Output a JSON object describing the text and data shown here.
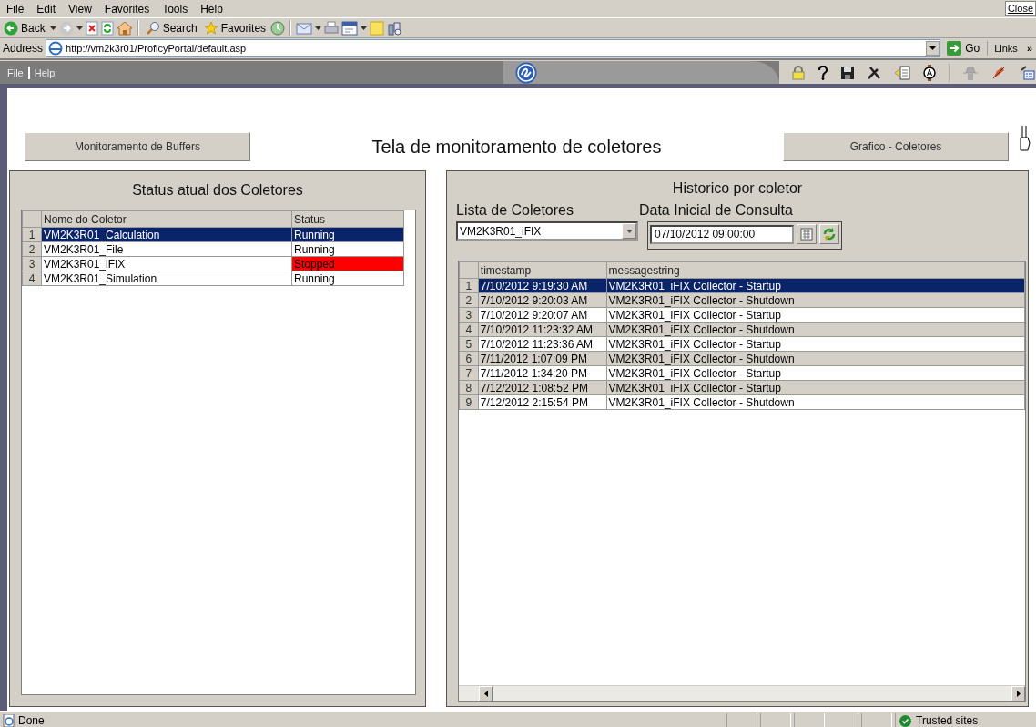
{
  "browser": {
    "menu": [
      "File",
      "Edit",
      "View",
      "Favorites",
      "Tools",
      "Help"
    ],
    "close_label": "Close",
    "toolbar": {
      "back": "Back",
      "search": "Search",
      "favorites": "Favorites"
    },
    "address": {
      "label": "Address",
      "value": "http://vm2k3r01/ProficyPortal/default.asp",
      "go": "Go",
      "links": "Links",
      "links_more": "»"
    }
  },
  "portal": {
    "menu": [
      "File",
      "Help"
    ]
  },
  "header": {
    "left_button": "Monitoramento de Buffers",
    "title": "Tela de monitoramento de coletores",
    "right_button": "Grafico - Coletores"
  },
  "status_panel": {
    "title": "Status atual dos Coletores",
    "columns": [
      "Nome do Coletor",
      "Status"
    ],
    "rows": [
      {
        "number": "1",
        "name": "VM2K3R01_Calculation",
        "status": "Running",
        "selected": true
      },
      {
        "number": "2",
        "name": "VM2K3R01_File",
        "status": "Running",
        "color": "#ffffff",
        "selected": false
      },
      {
        "number": "3",
        "name": "VM2K3R01_iFIX",
        "status": "Stopped",
        "color": "#ff0000",
        "selected": false
      },
      {
        "number": "4",
        "name": "VM2K3R01_Simulation",
        "status": "Running",
        "color": "#ffffff",
        "selected": false
      }
    ]
  },
  "history_panel": {
    "title": "Historico por coletor",
    "collector_label": "Lista de Coletores",
    "collector_value": "VM2K3R01_iFIX",
    "date_label": "Data Inicial de Consulta",
    "date_value": "07/10/2012 09:00:00",
    "columns": [
      "timestamp",
      "messagestring"
    ],
    "rows": [
      {
        "number": "1",
        "timestamp": "7/10/2012 9:19:30 AM",
        "message": "VM2K3R01_iFIX Collector - Startup",
        "selected": true
      },
      {
        "number": "2",
        "timestamp": "7/10/2012 9:20:03 AM",
        "message": "VM2K3R01_iFIX Collector - Shutdown",
        "selected": false
      },
      {
        "number": "3",
        "timestamp": "7/10/2012 9:20:07 AM",
        "message": "VM2K3R01_iFIX Collector - Startup",
        "selected": false
      },
      {
        "number": "4",
        "timestamp": "7/10/2012 11:23:32 AM",
        "message": "VM2K3R01_iFIX Collector - Shutdown",
        "selected": false
      },
      {
        "number": "5",
        "timestamp": "7/10/2012 11:23:36 AM",
        "message": "VM2K3R01_iFIX Collector - Startup",
        "selected": false
      },
      {
        "number": "6",
        "timestamp": "7/11/2012 1:07:09 PM",
        "message": "VM2K3R01_iFIX Collector - Shutdown",
        "selected": false
      },
      {
        "number": "7",
        "timestamp": "7/11/2012 1:34:20 PM",
        "message": "VM2K3R01_iFIX Collector - Startup",
        "selected": false
      },
      {
        "number": "8",
        "timestamp": "7/12/2012 1:08:52 PM",
        "message": "VM2K3R01_iFIX Collector - Startup",
        "selected": false
      },
      {
        "number": "9",
        "timestamp": "7/12/2012 2:15:54 PM",
        "message": "VM2K3R01_iFIX Collector - Shutdown",
        "selected": false
      }
    ]
  },
  "status_bar": {
    "text": "Done",
    "zone": "Trusted sites"
  }
}
